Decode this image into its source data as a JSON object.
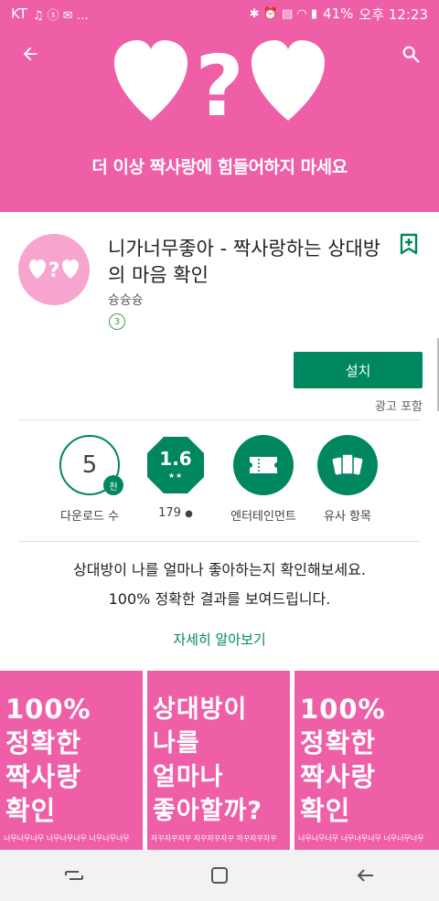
{
  "status_bar": {
    "carrier": "KT",
    "battery": "41%",
    "time": "오후 12:23"
  },
  "hero": {
    "tagline": "더 이상 짝사랑에 힘들어하지 마세요"
  },
  "app": {
    "title": "니가너무좋아 - 짝사랑하는 상대방의 마음 확인",
    "developer": "슝슝슝",
    "age_rating": "3",
    "install_label": "설치",
    "ads_label": "광고 포함"
  },
  "stats": {
    "downloads_value": "5",
    "downloads_unit": "천",
    "downloads_label": "다운로드 수",
    "rating_value": "1.6",
    "rating_stars": "★★",
    "review_count": "179",
    "category_label": "엔터테인먼트",
    "similar_label": "유사 항목"
  },
  "description": {
    "line1": "상대방이 나를 얼마나 좋아하는지 확인해보세요.",
    "line2": "100% 정확한 결과를 보여드립니다.",
    "read_more": "자세히 알아보기"
  },
  "screenshots": [
    {
      "lines": [
        "100%",
        "정확한",
        "짝사랑",
        "확인"
      ],
      "caption": "너무너무너무 너무너무너무 너무너무너무"
    },
    {
      "lines": [
        "상대방이",
        "나를",
        "얼마나",
        "좋아할까?"
      ],
      "caption": "자꾸자꾸자꾸 자꾸자꾸자꾸 자꾸자꾸자꾸"
    },
    {
      "lines": [
        "100%",
        "정확한",
        "짝사랑",
        "확인"
      ],
      "caption": "너무너무너무 너무너무너무 너무너무너무"
    }
  ],
  "colors": {
    "brand_pink": "#ee5fa8",
    "play_green": "#01875f"
  }
}
